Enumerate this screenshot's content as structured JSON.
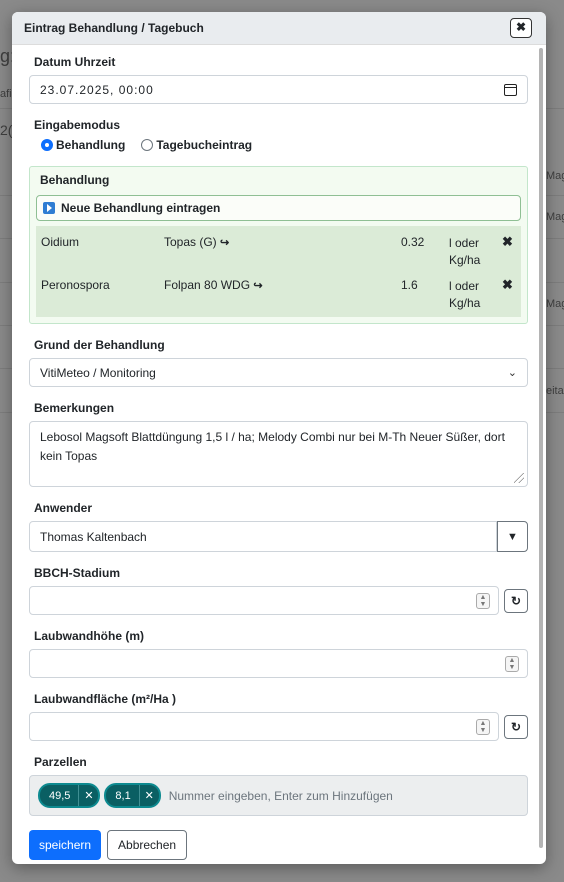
{
  "modal": {
    "title": "Eintrag Behandlung / Tagebuch",
    "close_icon": "close-x-icon"
  },
  "datetime": {
    "label": "Datum Uhrzeit",
    "value": "23.07.2025, 00:00"
  },
  "mode": {
    "label": "Eingabemodus",
    "options": [
      {
        "label": "Behandlung",
        "selected": true
      },
      {
        "label": "Tagebucheintrag",
        "selected": false
      }
    ]
  },
  "treatment": {
    "label": "Behandlung",
    "new_button": "Neue Behandlung eintragen",
    "rows": [
      {
        "disease": "Oidium",
        "product": "Topas (G)",
        "amount": "0.32",
        "unit": "l oder Kg/ha"
      },
      {
        "disease": "Peronospora",
        "product": "Folpan 80 WDG",
        "amount": "1.6",
        "unit": "l oder Kg/ha"
      }
    ]
  },
  "reason": {
    "label": "Grund der Behandlung",
    "value": "VitiMeteo / Monitoring"
  },
  "remarks": {
    "label": "Bemerkungen",
    "value": "Lebosol Magsoft Blattdüngung 1,5 l / ha; Melody Combi nur bei M-Th Neuer Süßer, dort kein Topas"
  },
  "user": {
    "label": "Anwender",
    "value": "Thomas Kaltenbach"
  },
  "bbch": {
    "label": "BBCH-Stadium",
    "value": ""
  },
  "height": {
    "label": "Laubwandhöhe (m)",
    "value": ""
  },
  "area": {
    "label": "Laubwandfläche (m²/Ha )",
    "value": ""
  },
  "parcels": {
    "label": "Parzellen",
    "tags": [
      "49,5",
      "8,1"
    ],
    "placeholder": "Nummer eingeben, Enter zum Hinzufügen"
  },
  "actions": {
    "save": "speichern",
    "cancel": "Abbrechen"
  },
  "background": {
    "fragments": [
      "g:",
      "afi",
      "2(",
      "Mag",
      "Mag",
      "Mag",
      "eitac"
    ]
  },
  "colors": {
    "primary": "#0d6efd",
    "tag": "#0a5f63",
    "green_box": "#f3fbf1"
  }
}
